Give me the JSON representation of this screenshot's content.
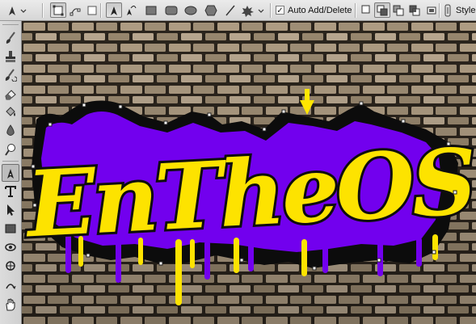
{
  "options_bar": {
    "tool_preset_icon": "pen-tool-icon",
    "mode_buttons": [
      "shape-layers-icon",
      "paths-icon",
      "fill-pixels-icon"
    ],
    "draw_tools": [
      "pen-icon",
      "freeform-pen-icon",
      "rectangle-icon",
      "rounded-rectangle-icon",
      "ellipse-icon",
      "polygon-icon",
      "line-icon",
      "custom-shape-icon"
    ],
    "auto_add_delete": {
      "label": "Auto Add/Delete",
      "checked": true
    },
    "path_ops": [
      "add-to-area-icon",
      "subtract-from-area-icon",
      "intersect-icon",
      "exclude-overlap-icon"
    ],
    "style_label": "Style"
  },
  "toolbox": {
    "tools": [
      "brush-icon",
      "clone-stamp-icon",
      "history-brush-icon",
      "eraser-icon",
      "paint-bucket-icon",
      "blur-icon",
      "dodge-icon",
      "pen-tool-icon",
      "type-tool-icon",
      "path-selection-icon",
      "rectangle-shape-icon",
      "3d-rotate-icon",
      "3d-orbit-icon",
      "hand-tool-icon"
    ],
    "active_tool": "pen-tool-icon"
  },
  "document": {
    "artwork_text": "EnTheOS",
    "colors": {
      "letter_fill": "#fde300",
      "letter_outline": "#0d0d0d",
      "purple_outline": "#7200ee",
      "brick": "#b8a58a",
      "mortar": "#2d261e",
      "arrow": "#ffe600"
    }
  }
}
